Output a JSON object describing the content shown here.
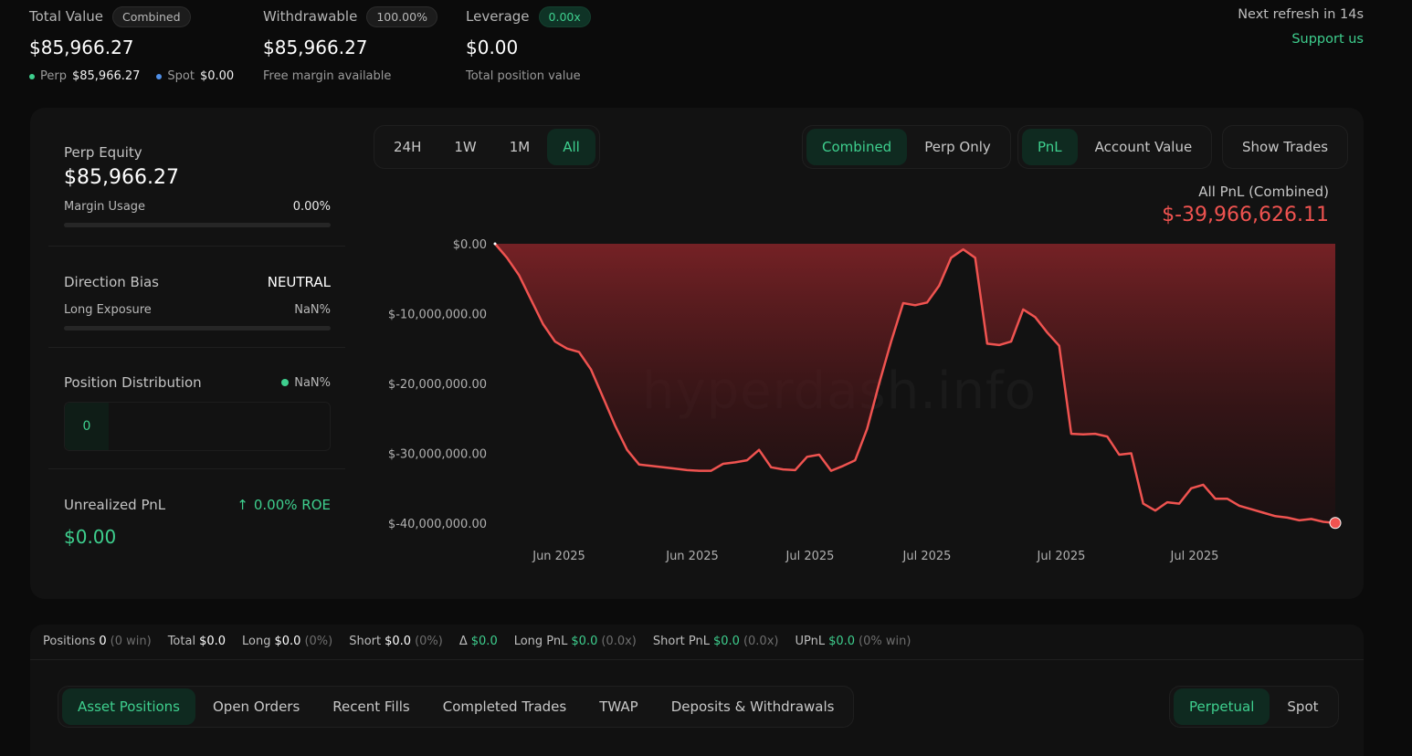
{
  "stats": {
    "total_value": {
      "label": "Total Value",
      "badge": "Combined",
      "value": "$85,966.27",
      "perp_label": "Perp",
      "perp_value": "$85,966.27",
      "spot_label": "Spot",
      "spot_value": "$0.00"
    },
    "withdrawable": {
      "label": "Withdrawable",
      "badge": "100.00%",
      "value": "$85,966.27",
      "sub": "Free margin available"
    },
    "leverage": {
      "label": "Leverage",
      "badge": "0.00x",
      "value": "$0.00",
      "sub": "Total position value"
    },
    "refresh": "Next refresh in 14s",
    "support": "Support us"
  },
  "left": {
    "perp_equity_label": "Perp Equity",
    "perp_equity_value": "$85,966.27",
    "margin_usage_label": "Margin Usage",
    "margin_usage_value": "0.00%",
    "direction_bias_label": "Direction Bias",
    "direction_bias_value": "NEUTRAL",
    "long_exposure_label": "Long Exposure",
    "long_exposure_value": "NaN%",
    "position_distribution_label": "Position Distribution",
    "position_distribution_value": "NaN%",
    "distribution_count": "0",
    "unrealized_label": "Unrealized PnL",
    "roe": "0.00% ROE",
    "unrealized_value": "$0.00"
  },
  "tabs": {
    "range": [
      "24H",
      "1W",
      "1M",
      "All"
    ],
    "range_active": 3,
    "scope": [
      "Combined",
      "Perp Only"
    ],
    "scope_active": 0,
    "metric": [
      "PnL",
      "Account Value"
    ],
    "metric_active": 0,
    "show_trades": "Show Trades"
  },
  "chart_data": {
    "type": "area",
    "title": "All PnL (Combined)",
    "total": "$-39,966,626.11",
    "color": "#ef5350",
    "ylim": [
      -40000000,
      0
    ],
    "yticks": [
      "$0.00",
      "$-10,000,000.00",
      "$-20,000,000.00",
      "$-30,000,000.00",
      "$-40,000,000.00"
    ],
    "ytick_values": [
      0,
      -10000000,
      -20000000,
      -30000000,
      -40000000
    ],
    "xticks": [
      "Jun 2025",
      "Jun 2025",
      "Jul 2025",
      "Jul 2025",
      "Jul 2025",
      "Jul 2025"
    ],
    "x": [
      0,
      1,
      2,
      3,
      4,
      5,
      6,
      7,
      8,
      9,
      10,
      11,
      12,
      13,
      14,
      15,
      16,
      17,
      18,
      19,
      20,
      21,
      22,
      23,
      24,
      25,
      26,
      27,
      28,
      29,
      30,
      31,
      32,
      33,
      34,
      35,
      36,
      37,
      38,
      39,
      40,
      41,
      42,
      43,
      44,
      45,
      46,
      47,
      48,
      49,
      50,
      51,
      52,
      53,
      54,
      55,
      56,
      57,
      58,
      59,
      60,
      61,
      62,
      63,
      64,
      65,
      66,
      67,
      68,
      69,
      70
    ],
    "values": [
      0,
      -2000000,
      -4500000,
      -8000000,
      -11500000,
      -14000000,
      -15000000,
      -15500000,
      -18000000,
      -22000000,
      -26000000,
      -29500000,
      -31600000,
      -31800000,
      -32000000,
      -32200000,
      -32400000,
      -32500000,
      -32500000,
      -31500000,
      -31300000,
      -31000000,
      -29500000,
      -32000000,
      -32300000,
      -32400000,
      -30500000,
      -30200000,
      -32500000,
      -31800000,
      -31000000,
      -26500000,
      -20000000,
      -14000000,
      -8500000,
      -8800000,
      -8400000,
      -6000000,
      -2000000,
      -800000,
      -2000000,
      -14300000,
      -14500000,
      -14000000,
      -9400000,
      -10500000,
      -12700000,
      -14600000,
      -27200000,
      -27300000,
      -27200000,
      -27600000,
      -30200000,
      -30000000,
      -37200000,
      -38200000,
      -37000000,
      -37200000,
      -35000000,
      -34500000,
      -36500000,
      -36500000,
      -37500000,
      -38000000,
      -38500000,
      -39000000,
      -39200000,
      -39600000,
      -39400000,
      -39800000,
      -39966626
    ]
  },
  "watermark": "hyperdash.info",
  "summary": [
    {
      "label": "Positions",
      "value": "0",
      "extra": "(0 win)"
    },
    {
      "label": "Total",
      "value": "$0.0",
      "extra": ""
    },
    {
      "label": "Long",
      "value": "$0.0",
      "extra": "(0%)"
    },
    {
      "label": "Short",
      "value": "$0.0",
      "extra": "(0%)"
    },
    {
      "label": "Δ",
      "value": "$0.0",
      "extra": ""
    },
    {
      "label": "Long PnL",
      "value": "$0.0",
      "extra": "(0.0x)"
    },
    {
      "label": "Short PnL",
      "value": "$0.0",
      "extra": "(0.0x)"
    },
    {
      "label": "UPnL",
      "value": "$0.0",
      "extra": "(0% win)"
    }
  ],
  "bottom_tabs": [
    "Asset Positions",
    "Open Orders",
    "Recent Fills",
    "Completed Trades",
    "TWAP",
    "Deposits & Withdrawals"
  ],
  "bottom_tabs_active": 0,
  "market_tabs": [
    "Perpetual",
    "Spot"
  ],
  "market_tabs_active": 0
}
